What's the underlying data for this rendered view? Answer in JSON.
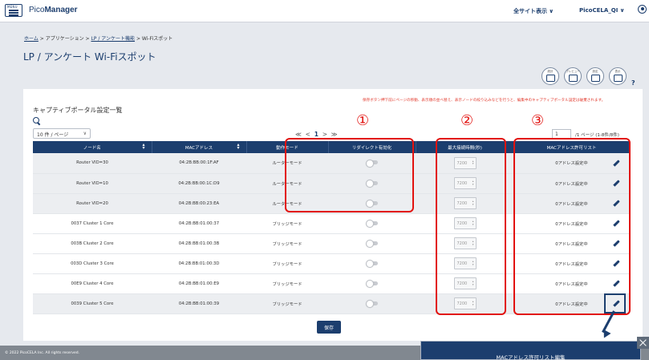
{
  "header": {
    "menu_label": "MENU",
    "logo_prefix": "Pico",
    "logo_suffix": "Manager",
    "all_sites": "全サイト表示 ∨",
    "user": "PicoCELA_QI ∨"
  },
  "breadcrumb": {
    "home": "ホーム",
    "sep": ">",
    "application": "アプリケーション",
    "lp": "LP / アンケート機能",
    "wifi": "Wi-Fiスポット"
  },
  "page_title": "LP / アンケート Wi-Fiスポット",
  "action_icons": [
    {
      "name": "chart",
      "caption": "統計"
    },
    {
      "name": "preview",
      "caption": "プレビュー"
    },
    {
      "name": "settings",
      "caption": "設定"
    },
    {
      "name": "list",
      "caption": "表示"
    }
  ],
  "help": "?",
  "notice": "保存ボタン押下前にページの移動、表示順の並べ替え、表示ノードの絞り込みなどを行うと、編集中のキャプティブポータル設定は破棄されます。",
  "list_title": "キャプティブポータル設定一覧",
  "per_page": "10 件 / ページ",
  "pager": {
    "prev_first": "≪",
    "prev": "<",
    "current": "1",
    "next": ">",
    "next_last": "≫"
  },
  "page_input": "1",
  "page_info": "/1 ページ (1-8件/8件)",
  "markers": [
    "①",
    "②",
    "③"
  ],
  "columns": {
    "node": "ノード名",
    "mac": "MACアドレス",
    "mode": "動作モード",
    "redirect": "リダイレクト有効化",
    "maxtime": "最大接続時間(秒)",
    "allowlist": "MACアドレス許可リスト"
  },
  "rows": [
    {
      "node": "Router VID=30",
      "mac": "04:2B:BB:00:1F:AF",
      "mode": "ルーターモード",
      "maxtime": "7200",
      "allow": "0アドレス設定中"
    },
    {
      "node": "Router VID=10",
      "mac": "04:2B:BB:00:1C:D9",
      "mode": "ルーターモード",
      "maxtime": "7200",
      "allow": "0アドレス設定中"
    },
    {
      "node": "Router VID=20",
      "mac": "04:2B:BB:00:23:EA",
      "mode": "ルーターモード",
      "maxtime": "7200",
      "allow": "0アドレス設定中"
    },
    {
      "node": "0037 Cluster 1 Core",
      "mac": "04:2B:BB:01:00:37",
      "mode": "ブリッジモード",
      "maxtime": "7200",
      "allow": "0アドレス設定中"
    },
    {
      "node": "003B Cluster 2 Core",
      "mac": "04:2B:BB:01:00:3B",
      "mode": "ブリッジモード",
      "maxtime": "7200",
      "allow": "0アドレス設定中"
    },
    {
      "node": "003D Cluster 3 Core",
      "mac": "04:2B:BB:01:00:3D",
      "mode": "ブリッジモード",
      "maxtime": "7200",
      "allow": "0アドレス設定中"
    },
    {
      "node": "00E9 Cluster 4 Core",
      "mac": "04:2B:BB:01:00:E9",
      "mode": "ブリッジモード",
      "maxtime": "7200",
      "allow": "0アドレス設定中"
    },
    {
      "node": "0039 Cluster 5 Core",
      "mac": "04:2B:BB:01:00:39",
      "mode": "ブリッジモード",
      "maxtime": "7200",
      "allow": "0アドレス設定中"
    }
  ],
  "save_label": "保存",
  "footer": "© 2022 PicoCELA Inc. All rights reserved.",
  "popup_title": "MACアドレス許可リスト編集",
  "colors": {
    "navy": "#1c3e6e",
    "annotation_red": "#e2120f",
    "notice_red": "#e23b2e"
  }
}
